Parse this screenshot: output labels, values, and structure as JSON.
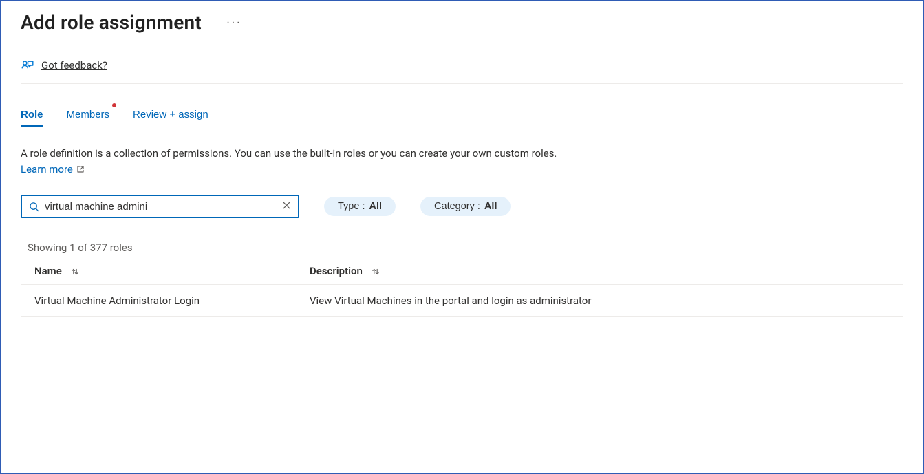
{
  "header": {
    "title": "Add role assignment"
  },
  "feedback": {
    "label": "Got feedback?"
  },
  "tabs": {
    "items": [
      {
        "label": "Role",
        "active": true,
        "dot": false
      },
      {
        "label": "Members",
        "active": false,
        "dot": true
      },
      {
        "label": "Review + assign",
        "active": false,
        "dot": false
      }
    ]
  },
  "description": {
    "text": "A role definition is a collection of permissions. You can use the built-in roles or you can create your own custom roles. ",
    "learn_more_label": "Learn more"
  },
  "search": {
    "value": "virtual machine admini"
  },
  "filters": {
    "type": {
      "label": "Type : ",
      "value": "All"
    },
    "category": {
      "label": "Category : ",
      "value": "All"
    }
  },
  "results": {
    "count_text": "Showing 1 of 377 roles",
    "columns": {
      "name": "Name",
      "description": "Description"
    },
    "rows": [
      {
        "name": "Virtual Machine Administrator Login",
        "description": "View Virtual Machines in the portal and login as administrator"
      }
    ]
  }
}
